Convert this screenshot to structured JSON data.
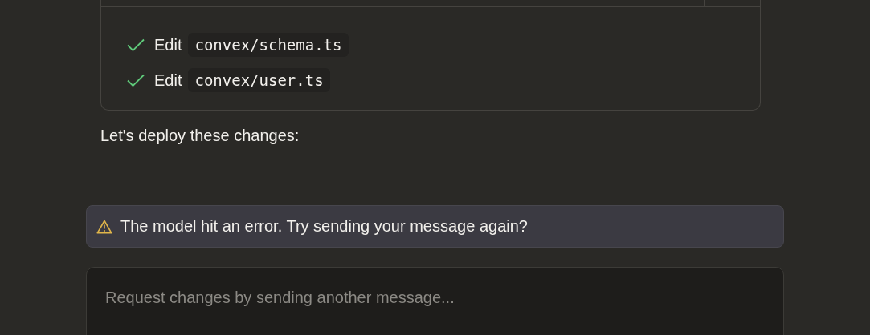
{
  "steps": [
    {
      "verb": "Edit",
      "path": "convex/schema.ts",
      "done": true
    },
    {
      "verb": "Edit",
      "path": "convex/user.ts",
      "done": true
    }
  ],
  "message": "Let's deploy these changes:",
  "error": {
    "text": "The model hit an error. Try sending your message again?"
  },
  "composer": {
    "placeholder": "Request changes by sending another message..."
  }
}
